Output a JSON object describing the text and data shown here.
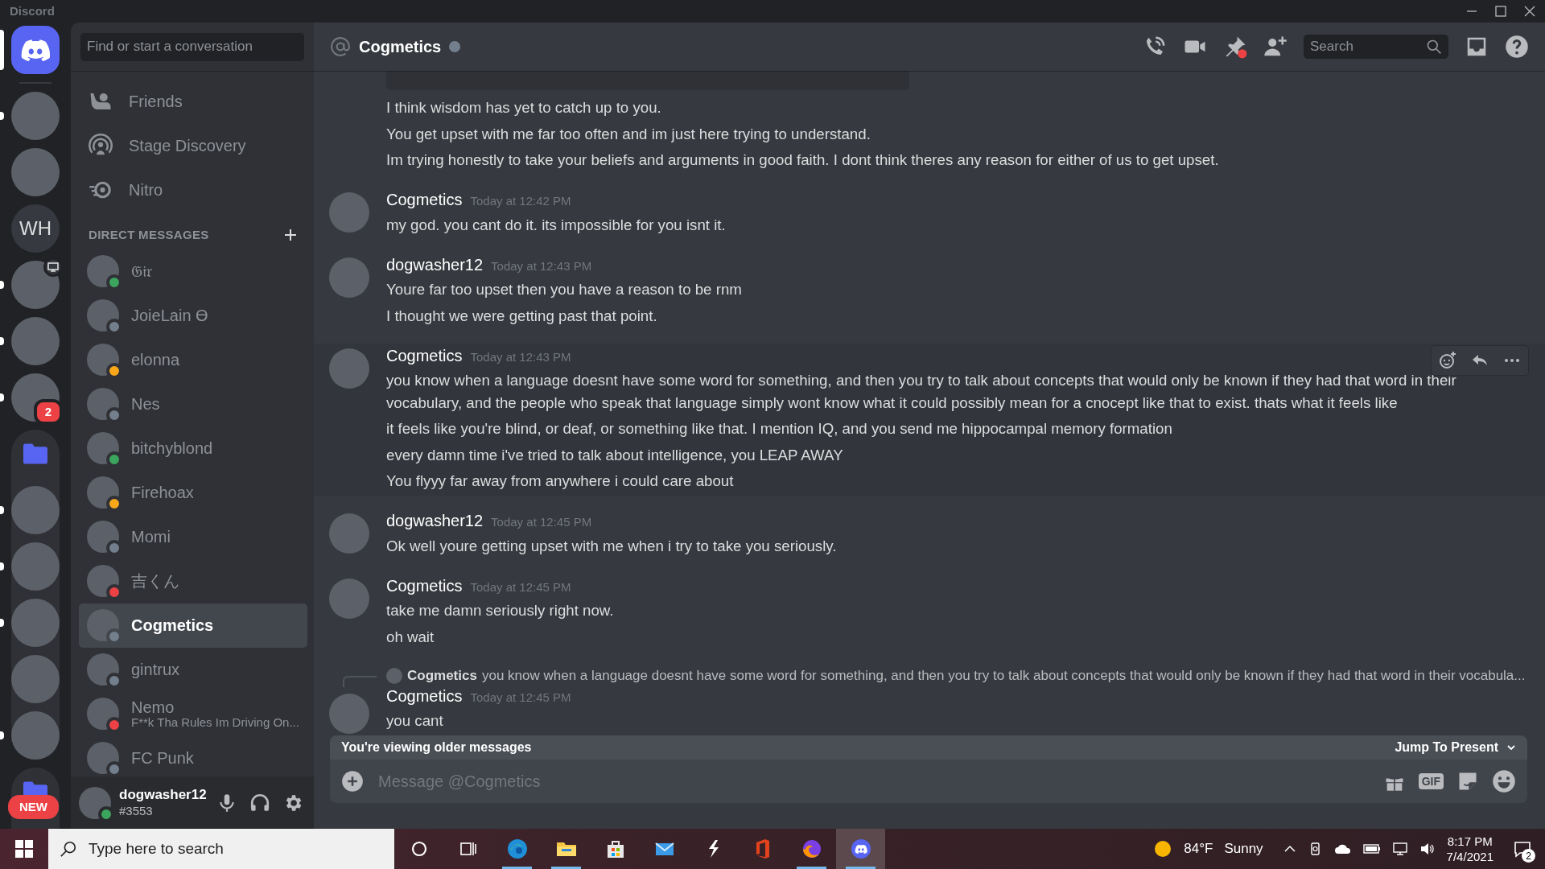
{
  "window": {
    "title": "Discord"
  },
  "servers": [
    {
      "kind": "home",
      "selected": true,
      "unread": false
    },
    {
      "kind": "image",
      "selected": false,
      "unread": true
    },
    {
      "kind": "image",
      "selected": false,
      "unread": false
    },
    {
      "kind": "text",
      "label": "WH",
      "selected": false,
      "unread": false
    },
    {
      "kind": "image",
      "selected": false,
      "unread": true,
      "screen_share": true
    },
    {
      "kind": "image",
      "selected": false,
      "unread": true
    },
    {
      "kind": "image",
      "selected": false,
      "unread": true,
      "mentions": "2"
    },
    {
      "kind": "folder",
      "selected": false,
      "unread": false,
      "expanded": true,
      "children": [
        {
          "kind": "image",
          "selected": false,
          "unread": true
        },
        {
          "kind": "image",
          "selected": false,
          "unread": true
        },
        {
          "kind": "image",
          "selected": false,
          "unread": true
        },
        {
          "kind": "image",
          "selected": false,
          "unread": false
        },
        {
          "kind": "image",
          "selected": false,
          "unread": true
        }
      ]
    },
    {
      "kind": "folder",
      "selected": false,
      "unread": false,
      "expanded": true
    }
  ],
  "new_badge": "NEW",
  "dm_sidebar": {
    "search_placeholder": "Find or start a conversation",
    "nav": [
      {
        "kind": "friends",
        "label": "Friends"
      },
      {
        "kind": "stage",
        "label": "Stage Discovery"
      },
      {
        "kind": "nitro",
        "label": "Nitro"
      }
    ],
    "section_title": "DIRECT MESSAGES",
    "items": [
      {
        "name": "𝔊𝔦𝔯",
        "color": "#3ba55d",
        "selected": false
      },
      {
        "name": "JoieLain ϴ",
        "color": "#747f8d",
        "selected": false
      },
      {
        "name": "elonna",
        "color": "#faa81a",
        "selected": false
      },
      {
        "name": "Nes",
        "color": "#747f8d",
        "selected": false
      },
      {
        "name": "bitchyblond",
        "color": "#3ba55d",
        "selected": false
      },
      {
        "name": "Firehoax",
        "color": "#faa81a",
        "selected": false
      },
      {
        "name": "Momi",
        "color": "#747f8d",
        "selected": false
      },
      {
        "name": "吉くん",
        "color": "#ed4245",
        "selected": false
      },
      {
        "name": "Cogmetics",
        "color": "#747f8d",
        "selected": true
      },
      {
        "name": "gintrux",
        "color": "#747f8d",
        "selected": false
      },
      {
        "name": "Nemo",
        "color": "#ed4245",
        "selected": false,
        "subtitle": "F**k Tha Rules Im Driving On..."
      },
      {
        "name": "FC Punk",
        "color": "#747f8d",
        "selected": false
      }
    ]
  },
  "user_panel": {
    "name": "dogwasher12",
    "tag": "#3553",
    "status": {
      "color": "#3ba55d"
    }
  },
  "header": {
    "name": "Cogmetics",
    "status": {
      "color": "#747f8d"
    },
    "pin_alert": true,
    "search_placeholder": "Search"
  },
  "messages": [
    {
      "embed": true,
      "lines": [
        "I think wisdom has yet to catch up to you.",
        "You get upset with me far too often and im just here trying to understand.",
        "Im trying honestly to take your beliefs and arguments in good faith. I dont think theres any reason for either of us to get upset."
      ]
    },
    {
      "author": "Cogmetics",
      "time": "Today at 12:42 PM",
      "lines": [
        "my god. you cant do it. its impossible for you isnt it."
      ]
    },
    {
      "author": "dogwasher12",
      "time": "Today at 12:43 PM",
      "lines": [
        "Youre far too upset then you have a reason to be rnm",
        "I thought we were getting past that point."
      ]
    },
    {
      "author": "Cogmetics",
      "time": "Today at 12:43 PM",
      "hovered": true,
      "lines": [
        "you know when a language doesnt have some word for something, and then you try to talk about concepts that would only be known if they had that word in their vocabulary, and the people who speak that language simply wont know what it could possibly mean for a cnocept like that to exist. thats what it feels like",
        "it feels like you're blind, or deaf, or something like that. I mention IQ, and you send me hippocampal memory formation",
        "every damn time i've tried to talk about intelligence, you LEAP AWAY",
        "You flyyy far away from anywhere i could care about"
      ]
    },
    {
      "author": "dogwasher12",
      "time": "Today at 12:45 PM",
      "lines": [
        "Ok well youre getting upset with me when i try to take you seriously."
      ]
    },
    {
      "author": "Cogmetics",
      "time": "Today at 12:45 PM",
      "lines": [
        "take me damn seriously right now.",
        "oh wait"
      ]
    },
    {
      "author": "Cogmetics",
      "time": "Today at 12:45 PM",
      "reply": {
        "author": "Cogmetics",
        "text": "you know when a language doesnt have some word for something, and then you try to talk about concepts that would only be known if they had that word in their vocabula..."
      },
      "lines": [
        "you cant"
      ]
    }
  ],
  "older_bar": {
    "text": "You're viewing older messages",
    "jump": "Jump To Present"
  },
  "composer": {
    "placeholder": "Message @Cogmetics",
    "gif_label": "GIF"
  },
  "taskbar": {
    "search_placeholder": "Type here to search",
    "apps": [
      {
        "kind": "edge",
        "running": true,
        "active": false
      },
      {
        "kind": "explorer",
        "running": true,
        "active": false
      },
      {
        "kind": "store",
        "running": false,
        "active": false
      },
      {
        "kind": "mail",
        "running": false,
        "active": false
      },
      {
        "kind": "bolt",
        "running": false,
        "active": false
      },
      {
        "kind": "office",
        "running": false,
        "active": false
      },
      {
        "kind": "firefox",
        "running": true,
        "active": false
      },
      {
        "kind": "discord",
        "running": true,
        "active": true
      }
    ],
    "weather": {
      "temp": "84°F",
      "condition": "Sunny"
    },
    "time": "8:17 PM",
    "date": "7/4/2021",
    "notifications": "2"
  }
}
